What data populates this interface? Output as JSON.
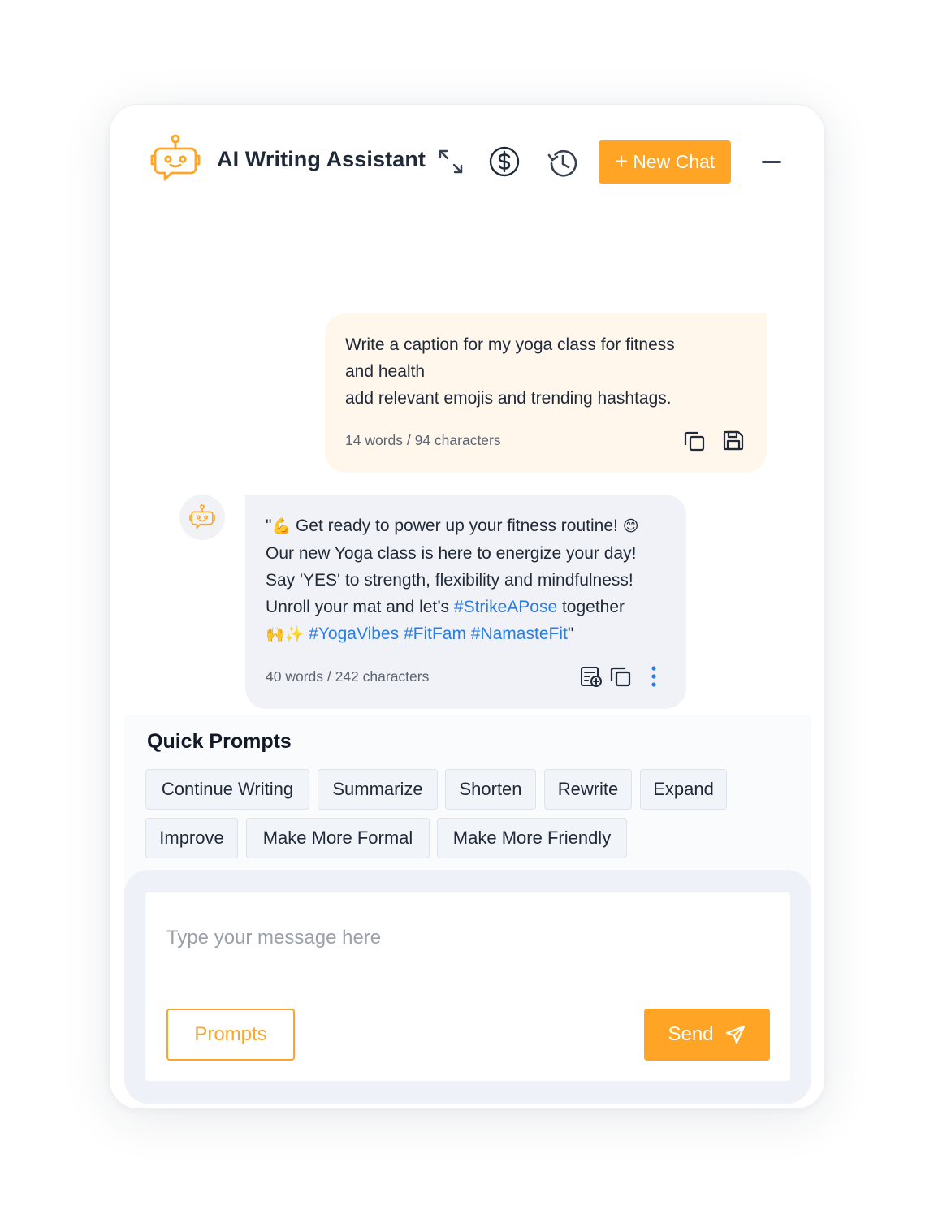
{
  "header": {
    "title": "AI Writing Assistant",
    "new_chat_label": "New Chat",
    "new_chat_plus": "+",
    "icons": [
      "robot-logo-icon",
      "expand-icon",
      "dollar-icon",
      "history-icon",
      "minimize-icon"
    ]
  },
  "colors": {
    "accent": "#ffa425",
    "user_bubble": "#fff6ec",
    "bot_bubble": "#f0f2f7",
    "hashtag": "#2a7de1"
  },
  "user_message": {
    "lines": [
      "Write a caption for my yoga class for fitness",
      "and health",
      "add relevant emojis and trending hashtags."
    ],
    "meta": "14 words / 94 characters"
  },
  "bot_message": {
    "line1_quote": "\"",
    "line1_emoji": "💪",
    "line1_text": " Get ready to power up your fitness routine! ",
    "line1_emoji_end": "😊",
    "line2": "Our new Yoga class is here to energize your day!",
    "line3": "Say 'YES' to strength, flexibility and mindfulness!",
    "line4_text": " Unroll your mat and let’s ",
    "line4_hashtag": "#StrikeAPose",
    "line4_end": " together",
    "line5_emoji": "🙌✨",
    "line5_hashtags": " #YogaVibes #FitFam #NamasteFit",
    "line5_end": "\"",
    "meta": "40 words / 242 characters"
  },
  "quick_prompts": {
    "title": "Quick Prompts",
    "items": [
      "Continue Writing",
      "Summarize",
      "Shorten",
      "Rewrite",
      "Expand",
      "Improve",
      "Make More Formal",
      "Make More Friendly"
    ]
  },
  "composer": {
    "placeholder": "Type your message here",
    "value": "",
    "prompts_label": "Prompts",
    "send_label": "Send"
  }
}
